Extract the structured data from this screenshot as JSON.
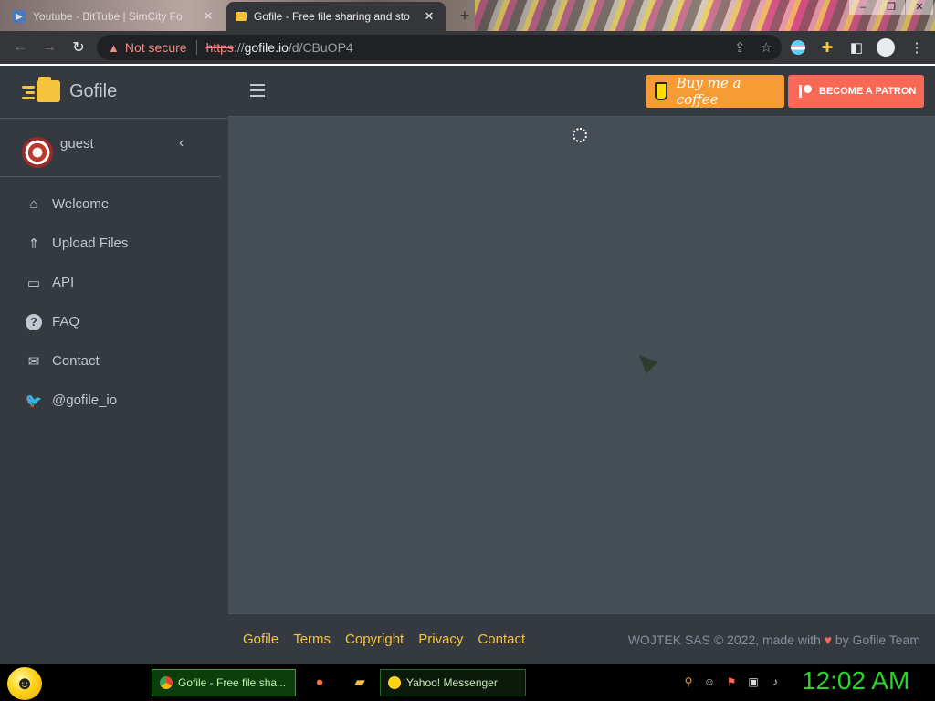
{
  "browser": {
    "tabs": [
      {
        "title": "Youtube - BitTube | SimCity Fo",
        "active": false
      },
      {
        "title": "Gofile - Free file sharing and sto",
        "active": true
      }
    ],
    "new_tab_label": "+",
    "security_label": "Not secure",
    "url_scheme": "https",
    "url_sep": "://",
    "url_host": "gofile.io",
    "url_path": "/d/CBuOP4"
  },
  "app": {
    "brand": "Gofile",
    "user": "guest",
    "nav": [
      {
        "label": "Welcome",
        "icon": "home-icon"
      },
      {
        "label": "Upload Files",
        "icon": "file-upload-icon"
      },
      {
        "label": "API",
        "icon": "laptop-code-icon"
      },
      {
        "label": "FAQ",
        "icon": "question-circle-icon"
      },
      {
        "label": "Contact",
        "icon": "envelope-icon"
      },
      {
        "label": "@gofile_io",
        "icon": "twitter-icon"
      }
    ],
    "buy_coffee": "Buy me a coffee",
    "become_patron": "BECOME A PATRON",
    "footer_links": [
      "Gofile",
      "Terms",
      "Copyright",
      "Privacy",
      "Contact"
    ],
    "footer_copy_prefix": "WOJTEK SAS © 2022, made with",
    "footer_copy_suffix": "by Gofile Team"
  },
  "taskbar": {
    "items": [
      "Gofile - Free file sha...",
      "Yahoo! Messenger"
    ],
    "clock": "12:02 AM"
  },
  "colors": {
    "accent": "#f6c33f",
    "coffee": "#f79b35",
    "patron": "#f96854",
    "clock": "#27d627"
  }
}
